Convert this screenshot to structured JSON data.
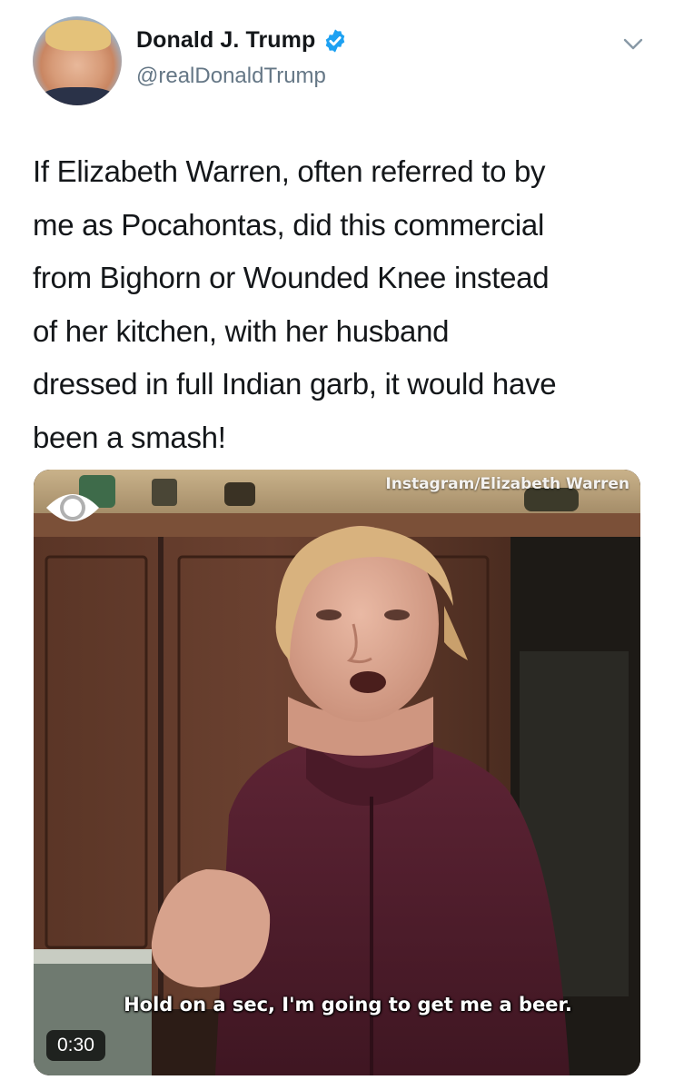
{
  "author": {
    "display_name": "Donald J. Trump",
    "handle": "@realDonaldTrump",
    "verified": true,
    "avatar_icon": "profile-photo",
    "menu_icon": "chevron-down-icon"
  },
  "tweet": {
    "text": "If Elizabeth Warren, often referred to by\nme as Pocahontas, did this commercial\nfrom Bighorn or Wounded Knee instead\nof her kitchen, with her husband\ndressed in full Indian garb, it would have\nbeen a smash!"
  },
  "media": {
    "type": "video",
    "watermark": "Instagram/Elizabeth Warren",
    "caption": "Hold on a sec, I'm going to get me a beer.",
    "duration": "0:30",
    "channel_logo_icon": "cbs-eye-logo"
  },
  "colors": {
    "verified_blue": "#1da1f2",
    "handle_gray": "#657786",
    "text": "#14171a"
  }
}
